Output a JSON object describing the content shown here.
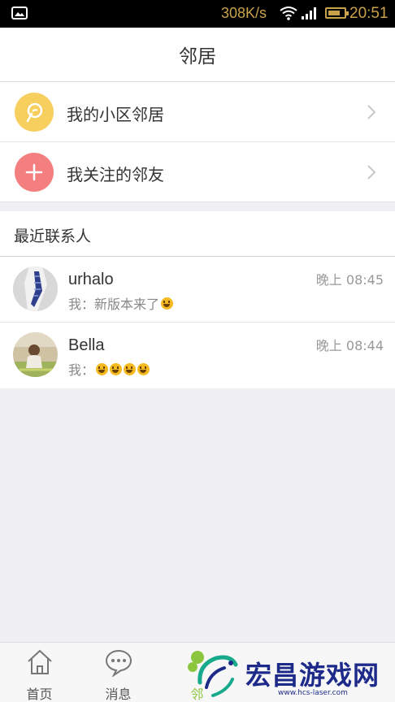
{
  "status_bar": {
    "speed": "308K/s",
    "time": "20:51",
    "accent_color": "#c9a24b"
  },
  "header": {
    "title": "邻居"
  },
  "menu": {
    "items": [
      {
        "label": "我的小区邻居",
        "icon": "community-icon",
        "color": "#f7cf5f"
      },
      {
        "label": "我关注的邻友",
        "icon": "plus-icon",
        "color": "#f47f7f"
      }
    ]
  },
  "recent_contacts": {
    "heading": "最近联系人",
    "items": [
      {
        "name": "urhalo",
        "message": "我：新版本来了",
        "emoji_count": 1,
        "time": "晚上 08:45"
      },
      {
        "name": "Bella",
        "message": "我：",
        "emoji_count": 4,
        "time": "晚上 08:44"
      }
    ]
  },
  "tab_bar": {
    "tabs": [
      {
        "label": "首页",
        "icon": "home-icon"
      },
      {
        "label": "消息",
        "icon": "chat-bubble-icon"
      },
      {
        "label": "邻",
        "icon": "neighbor-icon"
      }
    ]
  },
  "watermark": {
    "text": "宏昌游戏网",
    "url": "www.hcs-laser.com"
  }
}
